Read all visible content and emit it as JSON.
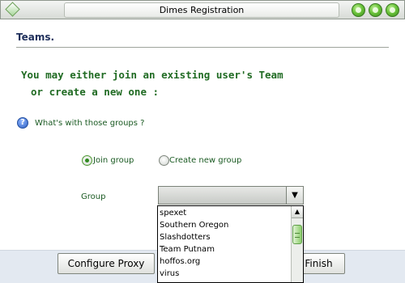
{
  "window": {
    "title": "Dimes Registration"
  },
  "page": {
    "section_title": "Teams.",
    "headline_line1": "You may either join an existing user's Team",
    "headline_line2": "or create a new one :",
    "help_link": "What's with those groups ?"
  },
  "form": {
    "radio_join": {
      "label": "Join group",
      "checked": true
    },
    "radio_create": {
      "label": "Create new group",
      "checked": false
    },
    "group_label": "Group",
    "group_value": "",
    "group_options": [
      "spexet",
      "Southern Oregon",
      "Slashdotters",
      "Team Putnam",
      "hoffos.org",
      "virus"
    ]
  },
  "buttons": {
    "configure_proxy": "Configure Proxy",
    "finish": "Finish"
  },
  "icons": {
    "window_menu": "diamond-icon",
    "window_controls": [
      "minimize-icon",
      "maximize-icon",
      "close-icon"
    ],
    "help": "help-icon",
    "combo_arrow": "chevron-down-icon"
  },
  "colors": {
    "heading_green": "#206b23",
    "section_title": "#1e2f5b",
    "accent_green": "#6bc43b"
  }
}
